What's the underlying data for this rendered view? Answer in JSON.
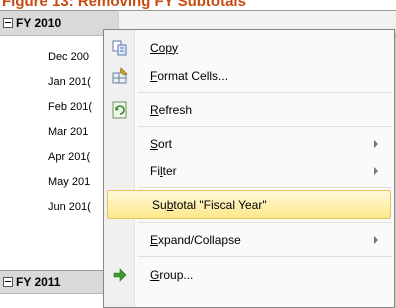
{
  "caption": "Figure 13: Removing FY Subtotals",
  "pivot": {
    "fy2010_label": "FY 2010",
    "fy2011_label": "FY 2011",
    "months": [
      "Dec 200",
      "Jan 201(",
      "Feb 201(",
      "Mar 201",
      "Apr 201(",
      "May 201",
      "Jun 201("
    ]
  },
  "context_menu": {
    "items": [
      {
        "label": "Copy",
        "accesskey_index": 0,
        "icon": "copy-icon"
      },
      {
        "label": "Format Cells...",
        "accesskey_index": 0,
        "icon": "format-cells-icon"
      },
      {
        "label": "Refresh",
        "accesskey_index": 0,
        "icon": "refresh-icon"
      },
      {
        "label": "Sort",
        "accesskey_index": 0,
        "submenu": true
      },
      {
        "label": "Filter",
        "accesskey_index": 2,
        "submenu": true
      },
      {
        "label": "Subtotal \"Fiscal Year\"",
        "accesskey_index": 2,
        "highlighted": true
      },
      {
        "label": "Expand/Collapse",
        "accesskey_index": 0,
        "submenu": true
      },
      {
        "label": "Group...",
        "accesskey_index": 0,
        "icon": "group-arrow-icon"
      }
    ]
  },
  "colors": {
    "caption": "#c84b12",
    "highlight": "#fde88a",
    "group_arrow": "#3a9a2a"
  }
}
